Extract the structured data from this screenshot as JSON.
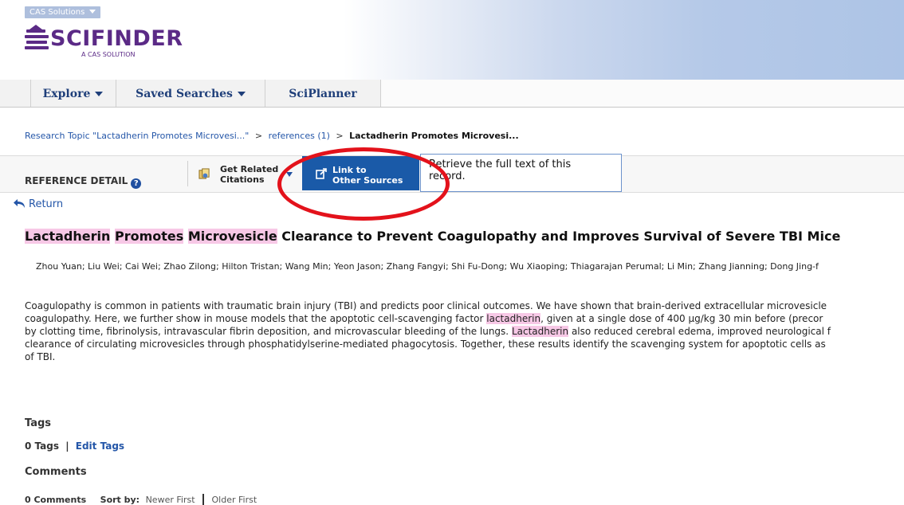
{
  "header": {
    "cas_menu": "CAS Solutions",
    "logo_word": "SCIFINDER",
    "logo_sub": "A CAS SOLUTION"
  },
  "nav": {
    "explore": "Explore",
    "saved_searches": "Saved Searches",
    "sciplanner": "SciPlanner"
  },
  "breadcrumb": {
    "research_topic": "Research Topic \"Lactadherin Promotes Microvesi...\"",
    "sep1": ">",
    "references": "references (1)",
    "sep2": ">",
    "current": "Lactadherin Promotes Microvesi..."
  },
  "toolbar": {
    "section_label": "REFERENCE DETAIL",
    "get_related_line1": "Get Related",
    "get_related_line2": "Citations",
    "link_line1": "Link to",
    "link_line2": "Other Sources",
    "tooltip_line1": "Retrieve the full text of this",
    "tooltip_line2": "record."
  },
  "return_label": "Return",
  "reference": {
    "title_parts": [
      "Lactadherin",
      " ",
      "Promotes",
      " ",
      "Microvesicle",
      " Clearance to Prevent Coagulopathy and Improves Survival of Severe TBI Mice"
    ],
    "authors": "Zhou Yuan; Liu Wei; Cai Wei; Zhao Zilong; Hilton Tristan; Wang Min; Yeon Jason; Zhang Fangyi; Shi Fu-Dong; Wu Xiaoping; Thiagarajan Perumal; Li Min; Zhang Jianning; Dong Jing-f",
    "abstract_lines": [
      "Coagulopathy is common in patients with traumatic brain injury (TBI) and predicts poor clinical outcomes.  We have shown that brain-derived extracellular microvesicle",
      "coagulopathy.  Here, we further show in mouse models that the apoptotic cell-scavenging factor ",
      "lactadherin",
      ", given at a single dose of 400 µg/kg 30 min before (precor",
      "by clotting time, fibrinolysis, intravascular fibrin deposition, and microvascular bleeding of the lungs.  ",
      "Lactadherin",
      " also reduced cerebral edema, improved neurological f",
      "clearance of circulating microvesicles through phosphatidylserine-mediated phagocytosis.  Together, these results identify the scavenging system for apoptotic cells as",
      "of TBI."
    ]
  },
  "tags": {
    "heading": "Tags",
    "count": "0 Tags",
    "divider": "|",
    "edit": "Edit Tags"
  },
  "comments": {
    "heading": "Comments",
    "count": "0 Comments",
    "sort_by": "Sort by:",
    "newer": "Newer First",
    "older": "Older First"
  },
  "colors": {
    "accent": "#1a5aa8",
    "highlight": "#f7c8e6",
    "annotation_ring": "#e3121b",
    "logo": "#5b2a86"
  }
}
